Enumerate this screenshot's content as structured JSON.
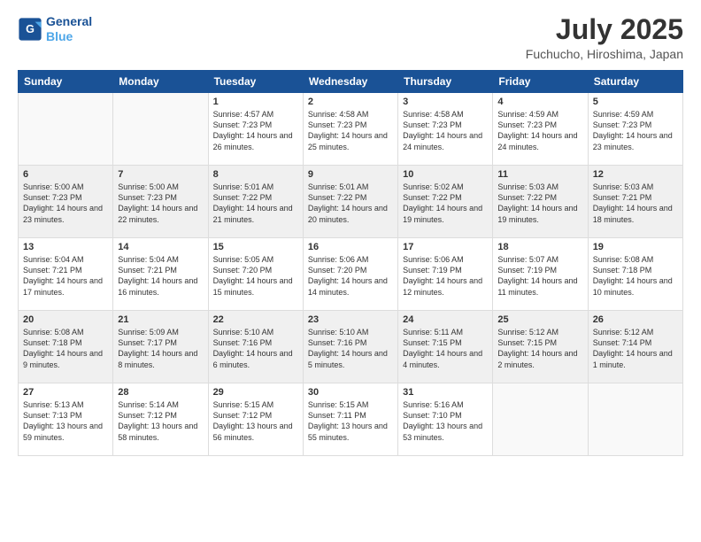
{
  "header": {
    "logo_line1": "General",
    "logo_line2": "Blue",
    "month": "July 2025",
    "location": "Fuchucho, Hiroshima, Japan"
  },
  "weekdays": [
    "Sunday",
    "Monday",
    "Tuesday",
    "Wednesday",
    "Thursday",
    "Friday",
    "Saturday"
  ],
  "weeks": [
    [
      {
        "day": "",
        "info": ""
      },
      {
        "day": "",
        "info": ""
      },
      {
        "day": "1",
        "info": "Sunrise: 4:57 AM\nSunset: 7:23 PM\nDaylight: 14 hours and 26 minutes."
      },
      {
        "day": "2",
        "info": "Sunrise: 4:58 AM\nSunset: 7:23 PM\nDaylight: 14 hours and 25 minutes."
      },
      {
        "day": "3",
        "info": "Sunrise: 4:58 AM\nSunset: 7:23 PM\nDaylight: 14 hours and 24 minutes."
      },
      {
        "day": "4",
        "info": "Sunrise: 4:59 AM\nSunset: 7:23 PM\nDaylight: 14 hours and 24 minutes."
      },
      {
        "day": "5",
        "info": "Sunrise: 4:59 AM\nSunset: 7:23 PM\nDaylight: 14 hours and 23 minutes."
      }
    ],
    [
      {
        "day": "6",
        "info": "Sunrise: 5:00 AM\nSunset: 7:23 PM\nDaylight: 14 hours and 23 minutes."
      },
      {
        "day": "7",
        "info": "Sunrise: 5:00 AM\nSunset: 7:23 PM\nDaylight: 14 hours and 22 minutes."
      },
      {
        "day": "8",
        "info": "Sunrise: 5:01 AM\nSunset: 7:22 PM\nDaylight: 14 hours and 21 minutes."
      },
      {
        "day": "9",
        "info": "Sunrise: 5:01 AM\nSunset: 7:22 PM\nDaylight: 14 hours and 20 minutes."
      },
      {
        "day": "10",
        "info": "Sunrise: 5:02 AM\nSunset: 7:22 PM\nDaylight: 14 hours and 19 minutes."
      },
      {
        "day": "11",
        "info": "Sunrise: 5:03 AM\nSunset: 7:22 PM\nDaylight: 14 hours and 19 minutes."
      },
      {
        "day": "12",
        "info": "Sunrise: 5:03 AM\nSunset: 7:21 PM\nDaylight: 14 hours and 18 minutes."
      }
    ],
    [
      {
        "day": "13",
        "info": "Sunrise: 5:04 AM\nSunset: 7:21 PM\nDaylight: 14 hours and 17 minutes."
      },
      {
        "day": "14",
        "info": "Sunrise: 5:04 AM\nSunset: 7:21 PM\nDaylight: 14 hours and 16 minutes."
      },
      {
        "day": "15",
        "info": "Sunrise: 5:05 AM\nSunset: 7:20 PM\nDaylight: 14 hours and 15 minutes."
      },
      {
        "day": "16",
        "info": "Sunrise: 5:06 AM\nSunset: 7:20 PM\nDaylight: 14 hours and 14 minutes."
      },
      {
        "day": "17",
        "info": "Sunrise: 5:06 AM\nSunset: 7:19 PM\nDaylight: 14 hours and 12 minutes."
      },
      {
        "day": "18",
        "info": "Sunrise: 5:07 AM\nSunset: 7:19 PM\nDaylight: 14 hours and 11 minutes."
      },
      {
        "day": "19",
        "info": "Sunrise: 5:08 AM\nSunset: 7:18 PM\nDaylight: 14 hours and 10 minutes."
      }
    ],
    [
      {
        "day": "20",
        "info": "Sunrise: 5:08 AM\nSunset: 7:18 PM\nDaylight: 14 hours and 9 minutes."
      },
      {
        "day": "21",
        "info": "Sunrise: 5:09 AM\nSunset: 7:17 PM\nDaylight: 14 hours and 8 minutes."
      },
      {
        "day": "22",
        "info": "Sunrise: 5:10 AM\nSunset: 7:16 PM\nDaylight: 14 hours and 6 minutes."
      },
      {
        "day": "23",
        "info": "Sunrise: 5:10 AM\nSunset: 7:16 PM\nDaylight: 14 hours and 5 minutes."
      },
      {
        "day": "24",
        "info": "Sunrise: 5:11 AM\nSunset: 7:15 PM\nDaylight: 14 hours and 4 minutes."
      },
      {
        "day": "25",
        "info": "Sunrise: 5:12 AM\nSunset: 7:15 PM\nDaylight: 14 hours and 2 minutes."
      },
      {
        "day": "26",
        "info": "Sunrise: 5:12 AM\nSunset: 7:14 PM\nDaylight: 14 hours and 1 minute."
      }
    ],
    [
      {
        "day": "27",
        "info": "Sunrise: 5:13 AM\nSunset: 7:13 PM\nDaylight: 13 hours and 59 minutes."
      },
      {
        "day": "28",
        "info": "Sunrise: 5:14 AM\nSunset: 7:12 PM\nDaylight: 13 hours and 58 minutes."
      },
      {
        "day": "29",
        "info": "Sunrise: 5:15 AM\nSunset: 7:12 PM\nDaylight: 13 hours and 56 minutes."
      },
      {
        "day": "30",
        "info": "Sunrise: 5:15 AM\nSunset: 7:11 PM\nDaylight: 13 hours and 55 minutes."
      },
      {
        "day": "31",
        "info": "Sunrise: 5:16 AM\nSunset: 7:10 PM\nDaylight: 13 hours and 53 minutes."
      },
      {
        "day": "",
        "info": ""
      },
      {
        "day": "",
        "info": ""
      }
    ]
  ]
}
